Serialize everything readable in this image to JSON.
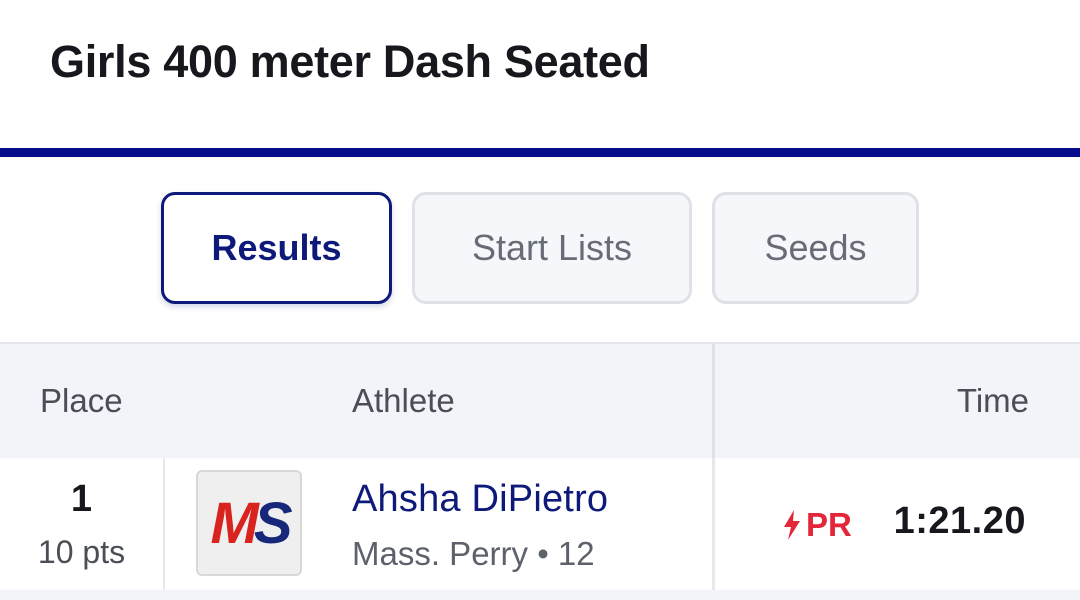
{
  "event": {
    "title": "Girls 400 meter Dash Seated"
  },
  "tabs": [
    {
      "label": "Results",
      "active": true
    },
    {
      "label": "Start Lists",
      "active": false
    },
    {
      "label": "Seeds",
      "active": false
    }
  ],
  "table": {
    "headers": {
      "place": "Place",
      "athlete": "Athlete",
      "time": "Time"
    },
    "rows": [
      {
        "place": "1",
        "points": "10 pts",
        "team_logo": {
          "text_m": "M",
          "text_s": "S",
          "icon": "team-logo-ms"
        },
        "athlete_name": "Ahsha DiPietro",
        "meta": "Mass. Perry • 12",
        "badge": {
          "label": "PR",
          "icon": "lightning-bolt-icon"
        },
        "time": "1:21.20"
      }
    ]
  },
  "colors": {
    "accent": "#070d8a",
    "link": "#0d1a7a",
    "pr": "#e3263a",
    "logo_red": "#d8231f",
    "logo_navy": "#17277a"
  }
}
